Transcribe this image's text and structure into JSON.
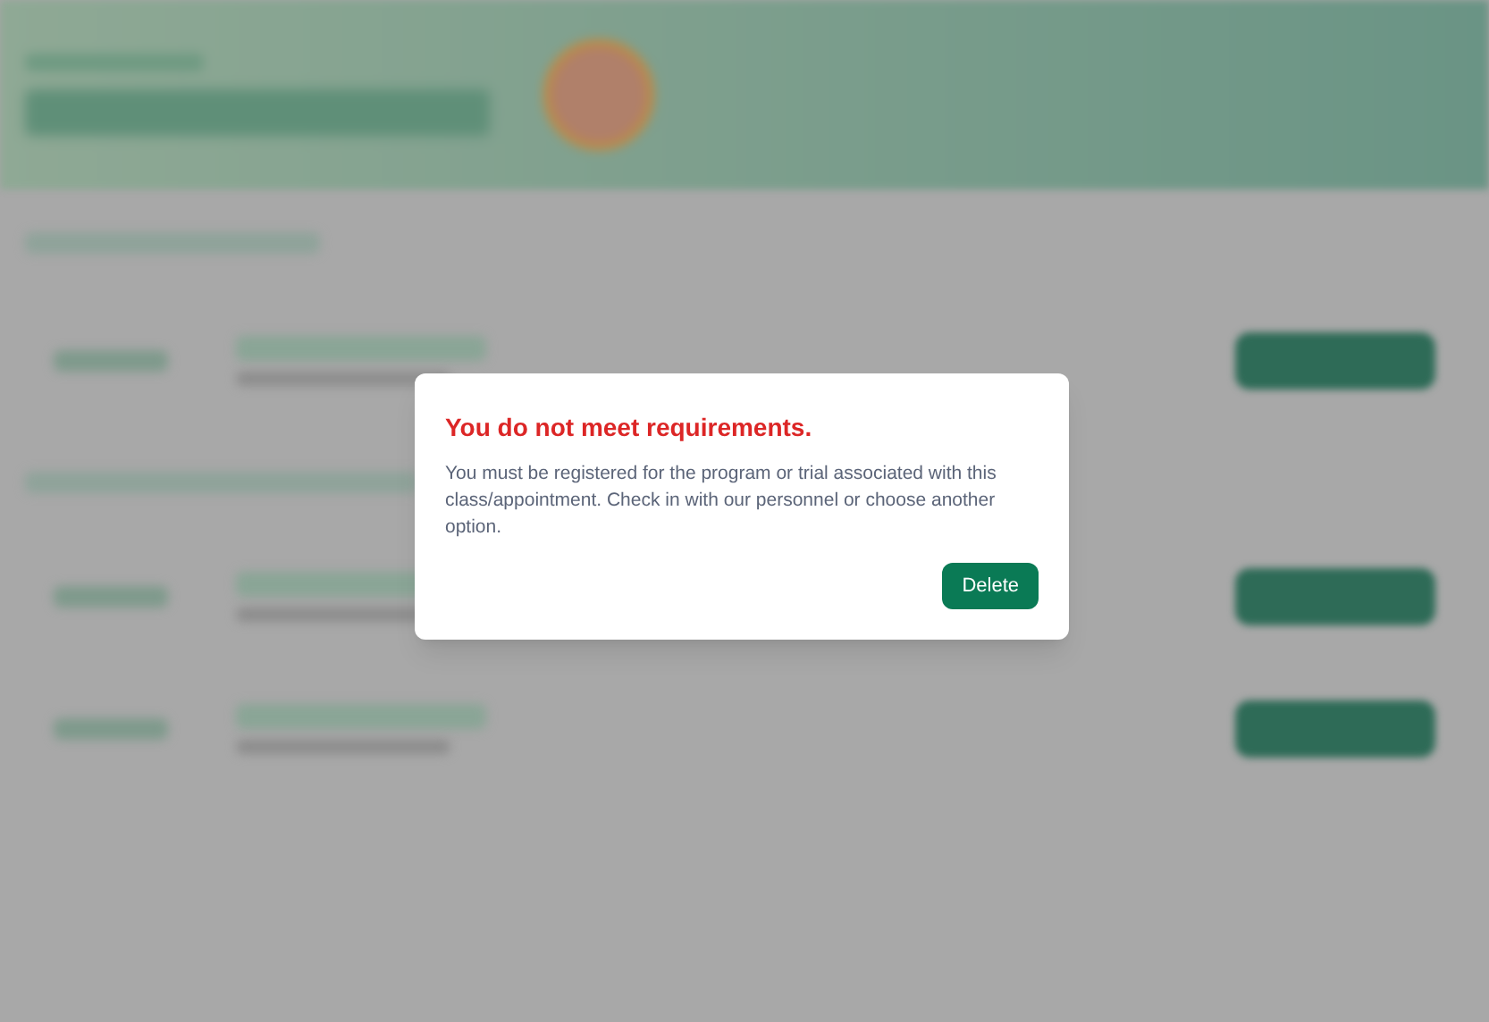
{
  "dialog": {
    "title": "You do not meet requirements.",
    "message": "You must be registered for the program or trial associated with this class/appointment. Check in with our personnel or choose another option.",
    "buttons": [
      {
        "label": "Delete",
        "kind": "primary"
      }
    ]
  }
}
